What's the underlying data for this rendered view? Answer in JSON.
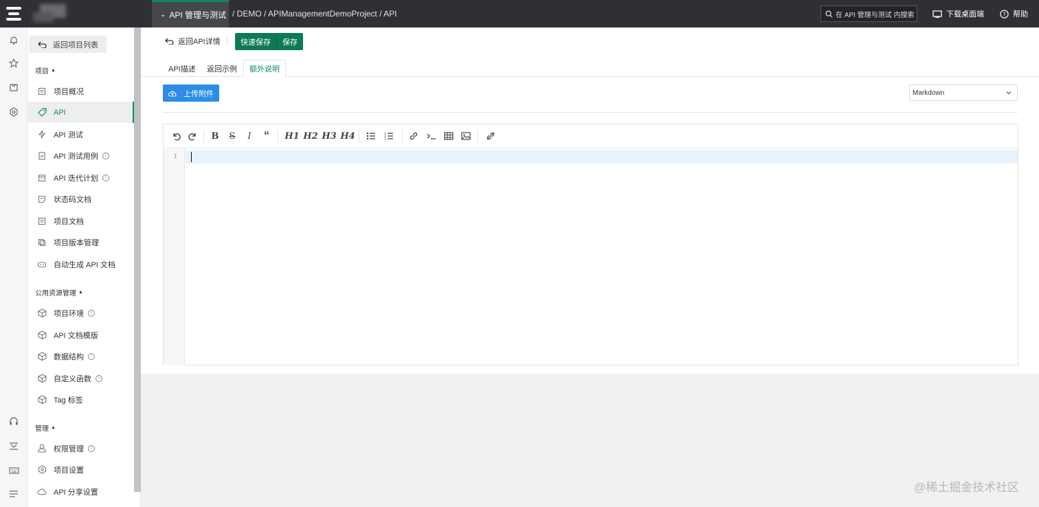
{
  "topbar": {
    "module": "API 管理与测试",
    "breadcrumb": "/ DEMO / APIManagementDemoProject / API",
    "search_placeholder": "在 API 管理与测试 内搜索",
    "download": "下载桌面端",
    "help": "帮助"
  },
  "sidebar": {
    "back": "返回项目列表",
    "sections": {
      "project": "项目",
      "public": "公用资源管理",
      "manage": "管理"
    },
    "items": [
      {
        "label": "项目概况"
      },
      {
        "label": "API"
      },
      {
        "label": "API 测试"
      },
      {
        "label": "API 测试用例"
      },
      {
        "label": "API 迭代计划"
      },
      {
        "label": "状态码文档"
      },
      {
        "label": "项目文档"
      },
      {
        "label": "项目版本管理"
      },
      {
        "label": "自动生成 API 文档"
      },
      {
        "label": "项目环境"
      },
      {
        "label": "API 文档模版"
      },
      {
        "label": "数据结构"
      },
      {
        "label": "自定义函数"
      },
      {
        "label": "Tag 标签"
      },
      {
        "label": "权限管理"
      },
      {
        "label": "项目设置"
      },
      {
        "label": "API 分享设置"
      }
    ]
  },
  "main": {
    "return_detail": "返回API详情",
    "quick_save": "快速保存",
    "save": "保存",
    "tabs": [
      "API描述",
      "返回示例",
      "额外说明"
    ],
    "upload": "上传附件",
    "format": "Markdown",
    "editor": {
      "line_number": "1",
      "headings": [
        "H1",
        "H2",
        "H3",
        "H4"
      ]
    }
  },
  "watermark": "@稀土掘金技术社区",
  "colors": {
    "accent": "#0f8c61",
    "upload": "#2b8de6",
    "topbar": "#2f3033"
  }
}
